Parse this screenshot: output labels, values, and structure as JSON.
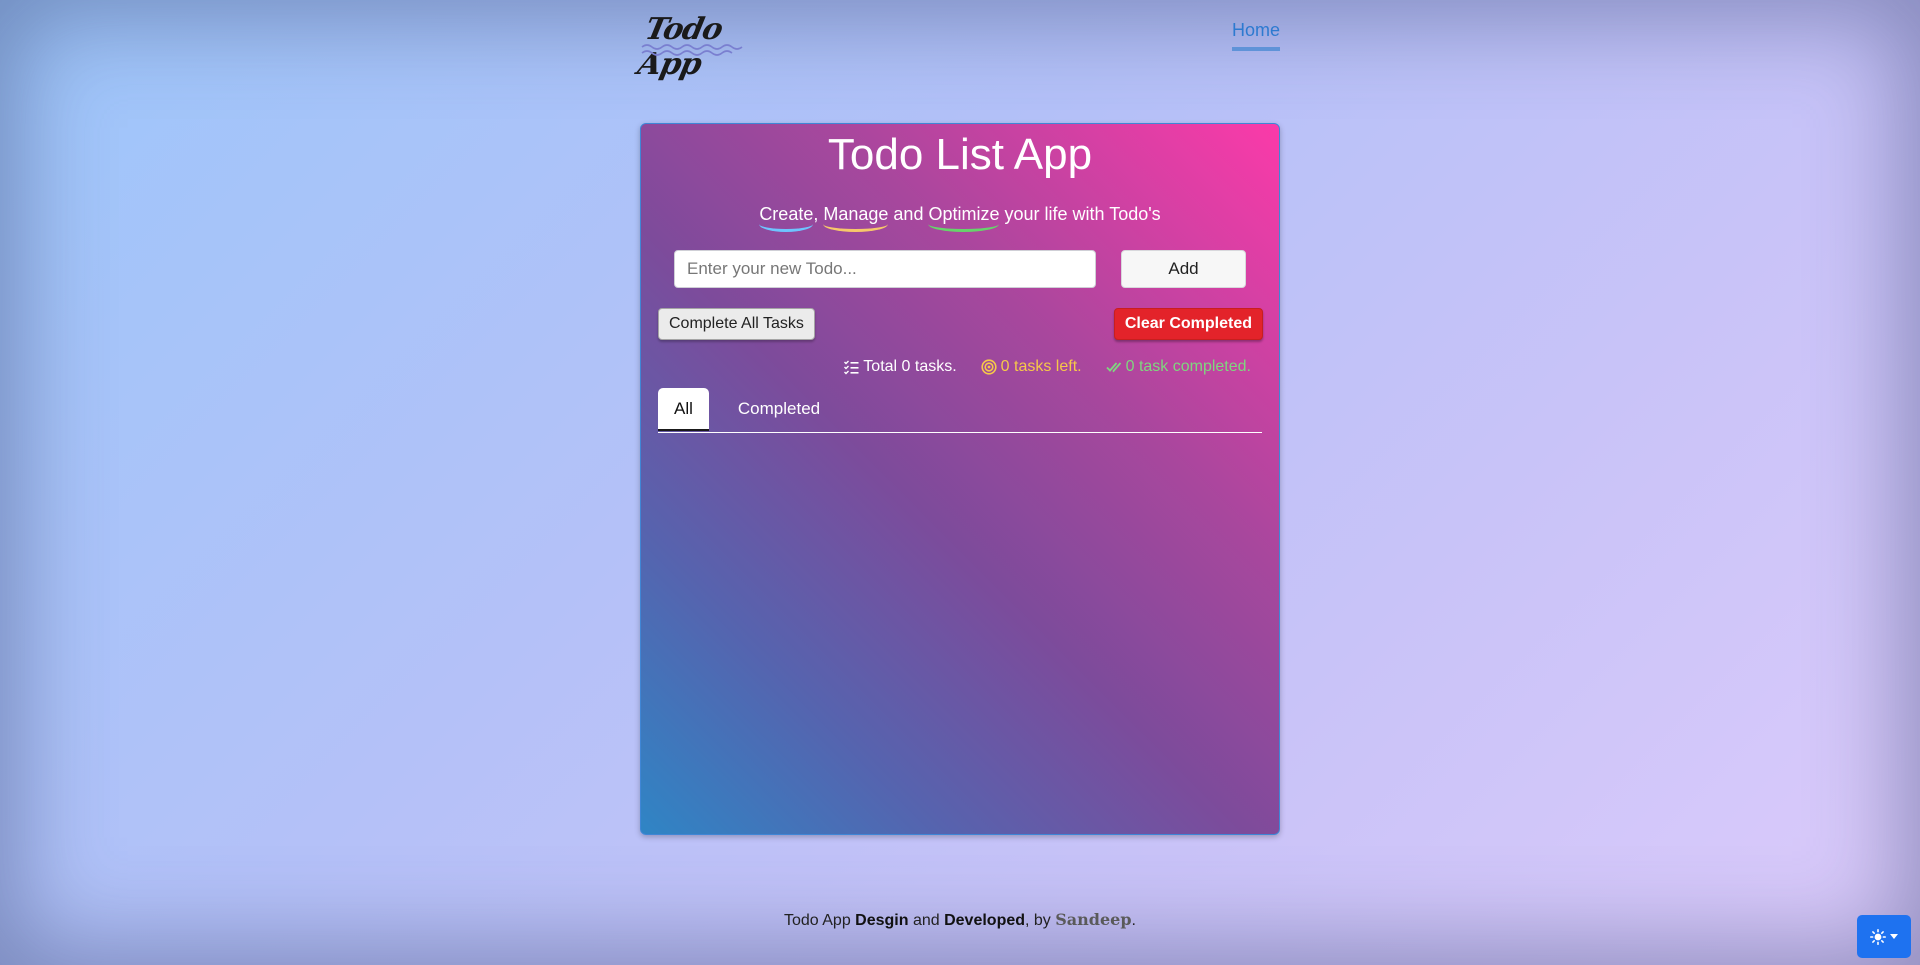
{
  "navbar": {
    "brand": "Todo App",
    "home_link": "Home"
  },
  "card": {
    "title": "Todo List App",
    "tagline": {
      "word1": "Create",
      "sep1": ", ",
      "word2": "Manage",
      "sep2": " and ",
      "word3": "Optimize",
      "rest": " your life with Todo's"
    },
    "input": {
      "placeholder": "Enter your new Todo...",
      "value": ""
    },
    "add_button": "Add",
    "complete_all_button": "Complete All Tasks",
    "clear_completed_button": "Clear Completed",
    "stats": {
      "total": "Total 0 tasks.",
      "left": "0 tasks left.",
      "completed": "0 task completed."
    },
    "tabs": [
      {
        "label": "All",
        "active": true
      },
      {
        "label": "Completed",
        "active": false
      }
    ]
  },
  "footer": {
    "part1": "Todo App ",
    "bold1": "Desgin",
    "part2": " and ",
    "bold2": "Developed",
    "part3": ", by ",
    "author": "Sandeep",
    "part4": "."
  },
  "theme_toggle": {
    "icon": "sun-icon"
  },
  "colors": {
    "accent_link": "#2d7ad0",
    "card_gradient_start": "#fb3aa9",
    "card_gradient_end": "#2f85c5",
    "danger": "#e3232a",
    "stat_left": "#f6c849",
    "stat_done": "#7fd67f",
    "theme_button": "#1e72f0"
  }
}
